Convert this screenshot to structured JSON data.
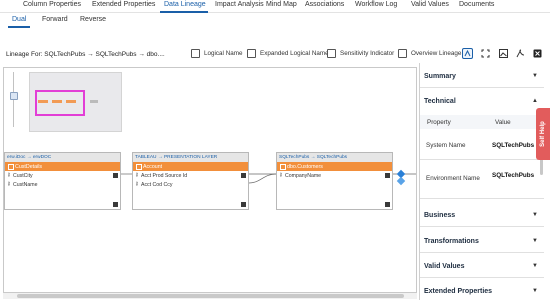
{
  "top_tabs": [
    "Column Properties",
    "Extended Properties",
    "Data Lineage",
    "Impact Analysis",
    "Mind Map",
    "Associations",
    "Workflow Log",
    "Valid Values",
    "Documents"
  ],
  "active_top_tab": "Data Lineage",
  "sub_tabs": [
    "Dual",
    "Forward",
    "Reverse"
  ],
  "active_sub_tab": "Dual",
  "toolbar": {
    "lineage_for": "Lineage For: SQLTechPubs → SQLTechPubs → dbo....",
    "checkboxes": [
      "Logical Name",
      "Expanded Logical Name",
      "Sensitivity Indicator",
      "Overview Lineage"
    ],
    "icons": [
      "fit-view-icon",
      "expand-icon",
      "image-export-icon",
      "pdf-export-icon",
      "excel-export-icon"
    ]
  },
  "nodes": [
    {
      "header": "erw.iDoc → erwDOC",
      "title": "CustDetails",
      "rows": [
        "CustCity",
        "CustName"
      ]
    },
    {
      "header": "TABLEAU → PRESENTATION LAYER",
      "title": "Account",
      "rows": [
        "Acct Prod Source Id",
        "Acct Cod Ccy"
      ]
    },
    {
      "header": "SQLTechPubs → SQLTechPubs",
      "title": "dbo.Customers",
      "rows": [
        "CompanyName"
      ]
    }
  ],
  "right_panel": {
    "sections": [
      "Summary",
      "Technical",
      "Business",
      "Transformations",
      "Valid Values",
      "Extended Properties"
    ],
    "table_headers": [
      "Property",
      "Value"
    ],
    "rows": [
      {
        "property": "System Name",
        "value": "SQLTechPubs"
      },
      {
        "property": "Environment Name",
        "value": "SQLTechPubs"
      }
    ]
  },
  "self_help": "Self Help",
  "colors": {
    "accent": "#1a5fa8",
    "node_title": "#f28f3b",
    "self_help": "#e25c5c",
    "minimap_view": "#e23ed6"
  }
}
